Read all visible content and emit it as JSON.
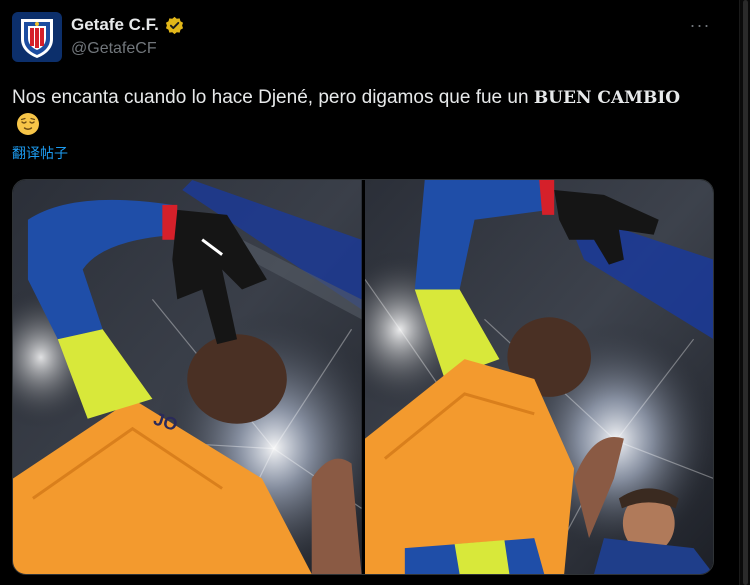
{
  "post": {
    "display_name": "Getafe C.F.",
    "handle": "@GetafeCF",
    "more_label": "···",
    "text_prefix": "Nos encanta cuando lo hace Djené, pero digamos que fue un ",
    "text_bold": "BUEN CAMBIO",
    "emoji_name": "relieved-face-emoji",
    "translate_label": "翻译帖子"
  },
  "colors": {
    "background": "#000000",
    "text": "#e7e9ea",
    "secondary_text": "#71767b",
    "link": "#1d9bf0",
    "verified_badge": "#e2b719",
    "jersey_orange": "#f39a2e",
    "sleeve_blue": "#1f4ea8",
    "sleeve_yellow": "#d8e83a"
  },
  "media": {
    "photos": [
      {
        "name": "goalkeeper-celebration-photo-1"
      },
      {
        "name": "goalkeeper-celebration-photo-2"
      }
    ]
  }
}
